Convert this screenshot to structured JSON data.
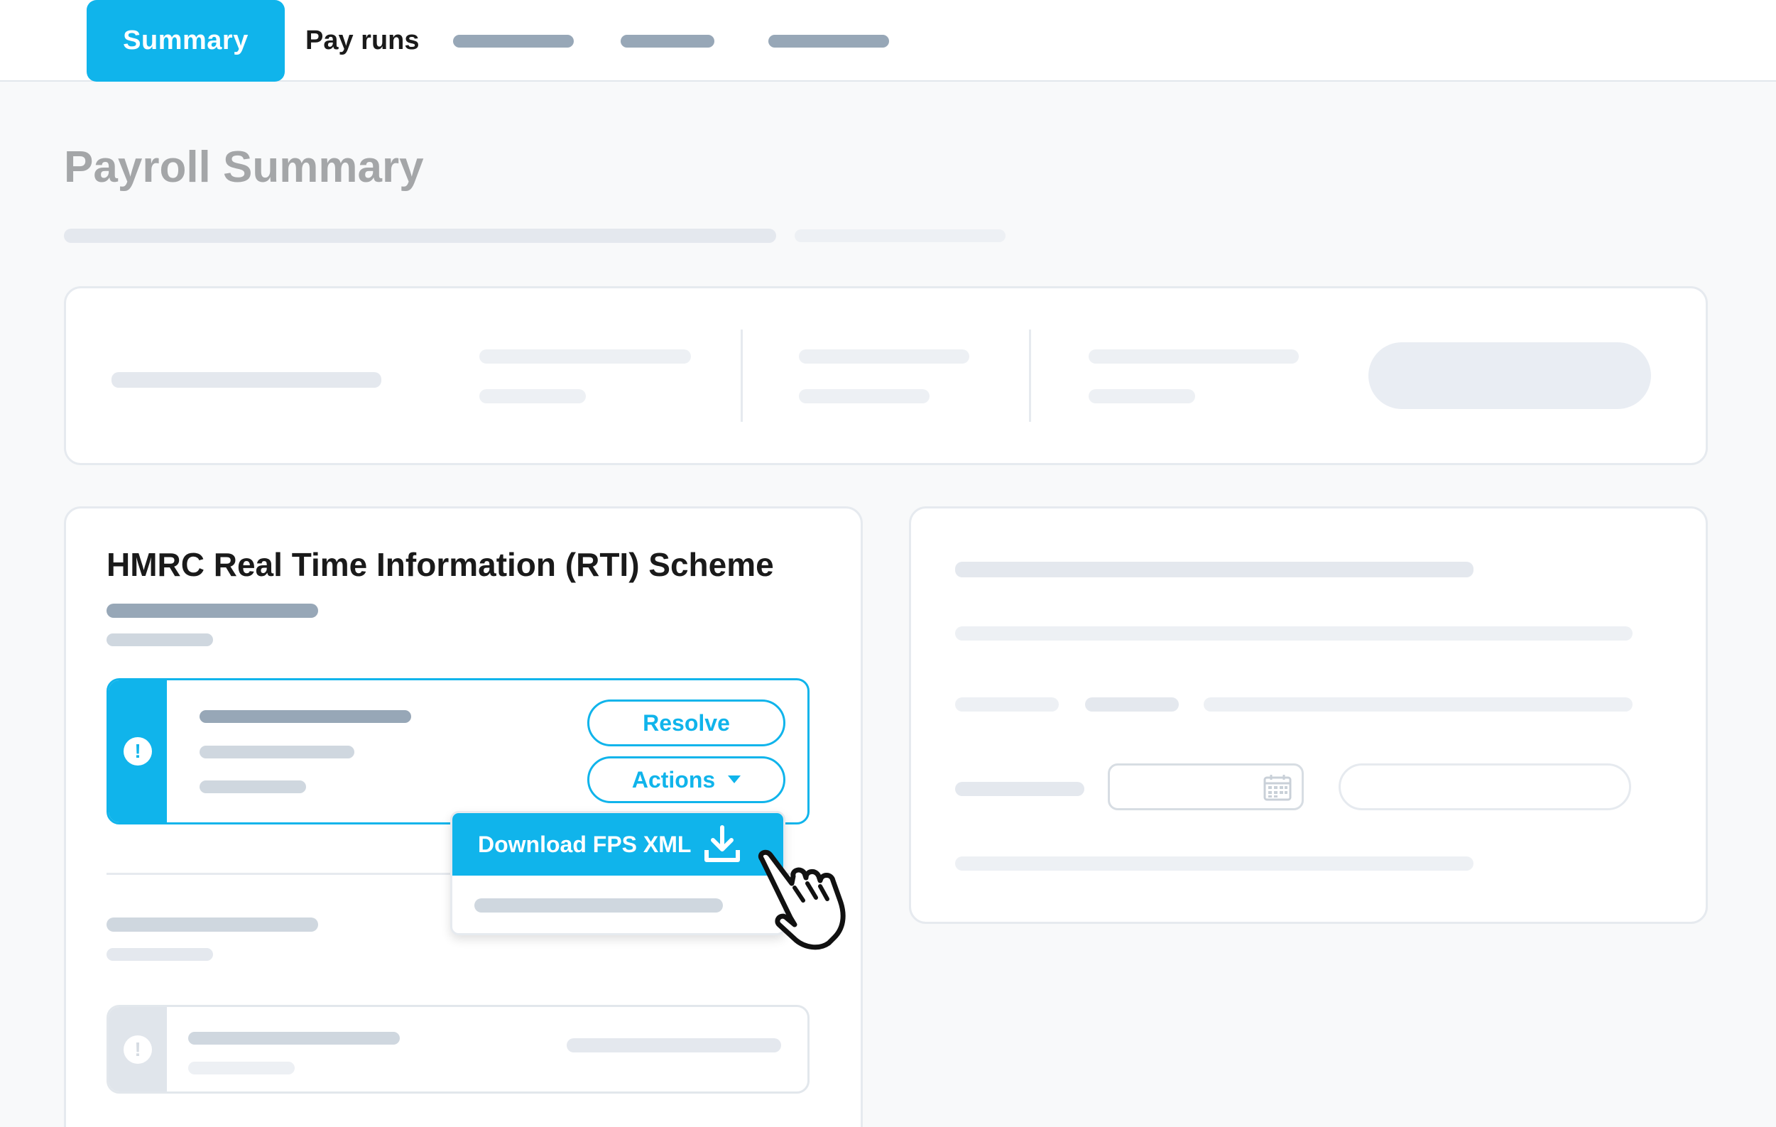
{
  "nav": {
    "tabs": [
      {
        "label": "Summary",
        "active": true
      },
      {
        "label": "Pay runs",
        "active": false
      }
    ]
  },
  "page": {
    "title": "Payroll Summary"
  },
  "rti_card": {
    "title": "HMRC Real Time Information (RTI) Scheme",
    "alert": {
      "icon": "exclamation-circle-icon",
      "icon_glyph": "!",
      "resolve_label": "Resolve",
      "actions_label": "Actions"
    },
    "dropdown": {
      "items": [
        {
          "label": "Download FPS XML",
          "icon": "download-icon"
        }
      ]
    },
    "alert_secondary": {
      "icon_glyph": "!"
    }
  },
  "colors": {
    "accent": "#10b4eb",
    "page_background": "#f8f9fa",
    "title_gray": "#a4a6a8"
  }
}
